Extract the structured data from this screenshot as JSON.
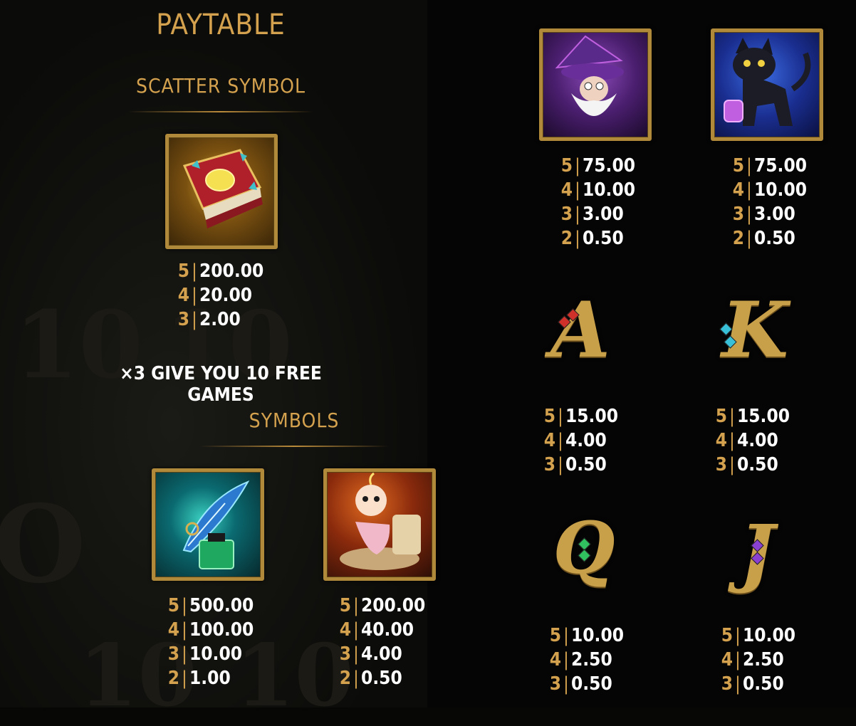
{
  "header": {
    "title": "PAYTABLE"
  },
  "scatter": {
    "heading": "SCATTER SYMBOL",
    "symbol": "spellbook-icon",
    "pays": [
      {
        "count": "5",
        "value": "200.00"
      },
      {
        "count": "4",
        "value": "20.00"
      },
      {
        "count": "3",
        "value": "2.00"
      }
    ],
    "note": "×3 GIVE YOU 10 FREE GAMES"
  },
  "symbols": {
    "heading": "SYMBOLS",
    "quill": {
      "symbol": "quill-inkwell-icon",
      "pays": [
        {
          "count": "5",
          "value": "500.00"
        },
        {
          "count": "4",
          "value": "100.00"
        },
        {
          "count": "3",
          "value": "10.00"
        },
        {
          "count": "2",
          "value": "1.00"
        }
      ]
    },
    "candle": {
      "symbol": "candle-spirit-icon",
      "pays": [
        {
          "count": "5",
          "value": "200.00"
        },
        {
          "count": "4",
          "value": "40.00"
        },
        {
          "count": "3",
          "value": "4.00"
        },
        {
          "count": "2",
          "value": "0.50"
        }
      ]
    },
    "wizard": {
      "symbol": "wizard-icon",
      "pays": [
        {
          "count": "5",
          "value": "75.00"
        },
        {
          "count": "4",
          "value": "10.00"
        },
        {
          "count": "3",
          "value": "3.00"
        },
        {
          "count": "2",
          "value": "0.50"
        }
      ]
    },
    "cat": {
      "symbol": "black-cat-icon",
      "pays": [
        {
          "count": "5",
          "value": "75.00"
        },
        {
          "count": "4",
          "value": "10.00"
        },
        {
          "count": "3",
          "value": "3.00"
        },
        {
          "count": "2",
          "value": "0.50"
        }
      ]
    },
    "ace": {
      "symbol": "letter-a-icon",
      "pays": [
        {
          "count": "5",
          "value": "15.00"
        },
        {
          "count": "4",
          "value": "4.00"
        },
        {
          "count": "3",
          "value": "0.50"
        }
      ]
    },
    "king": {
      "symbol": "letter-k-icon",
      "pays": [
        {
          "count": "5",
          "value": "15.00"
        },
        {
          "count": "4",
          "value": "4.00"
        },
        {
          "count": "3",
          "value": "0.50"
        }
      ]
    },
    "queen": {
      "symbol": "letter-q-icon",
      "pays": [
        {
          "count": "5",
          "value": "10.00"
        },
        {
          "count": "4",
          "value": "2.50"
        },
        {
          "count": "3",
          "value": "0.50"
        }
      ]
    },
    "jack": {
      "symbol": "letter-j-icon",
      "pays": [
        {
          "count": "5",
          "value": "10.00"
        },
        {
          "count": "4",
          "value": "2.50"
        },
        {
          "count": "3",
          "value": "0.50"
        }
      ]
    }
  },
  "letters": {
    "ace": "A",
    "king": "K",
    "queen": "Q",
    "jack": "J"
  },
  "colors": {
    "gold": "#d4a24e",
    "value_text": "#ffffff",
    "background": "#070706",
    "tile_border": "#b08a3a"
  }
}
